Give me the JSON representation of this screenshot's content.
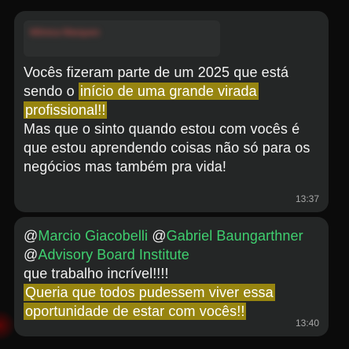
{
  "messages": [
    {
      "quoted_author": "Mônica Marques",
      "quoted_text": "",
      "line1": "Vocês fizeram parte de um 2025 que está",
      "line2_pre": "sendo o ",
      "highlight": "início de uma grande virada profissional!!",
      "line3": "Mas que o sinto quando estou com vocês é que estou aprendendo coisas não só para os negócios mas também pra vida!",
      "time": "13:37"
    },
    {
      "mention1": "Marcio Giacobelli",
      "mention2": "Gabriel Baungarthner",
      "mention3": "Advisory Board Institute",
      "text1": "que trabalho incrível!!!!",
      "highlight": "Queria que todos pudessem viver essa oportunidade de estar com vocês!!",
      "time": "13:40"
    }
  ],
  "colors": {
    "background": "#0b0b0b",
    "bubble": "#242626",
    "highlight": "#978510",
    "mention": "#3fcf6f"
  }
}
